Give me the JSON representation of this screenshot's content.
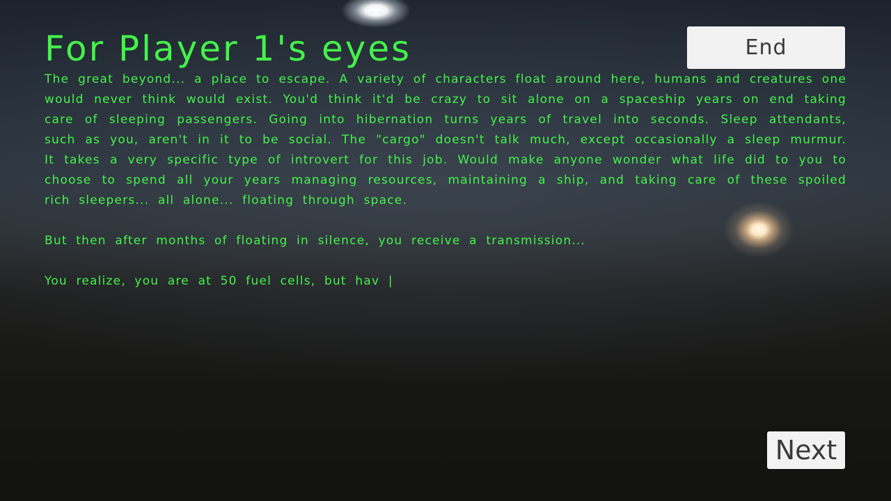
{
  "title": "For Player 1's eyes",
  "story": {
    "paragraph_1": "The great beyond... a place to escape. A variety of characters float around here, humans and creatures one would never think would exist. You'd think it'd be crazy to sit alone on a spaceship years on end taking care of sleeping passengers. Going into hibernation turns years of travel into seconds. Sleep attendants, such as you, aren't in it to be social. The \"cargo\" doesn't talk much, except occasionally a sleep murmur. It takes a very specific type of introvert for this job. Would make anyone wonder what life did to you to choose to spend all your years managing resources, maintaining a ship, and taking care of these spoiled rich sleepers... all alone... floating through space.",
    "paragraph_2": "But then after months of floating in silence, you receive a transmission...",
    "paragraph_3": "You realize, you are at 50 fuel cells, but hav |"
  },
  "buttons": {
    "end_label": "End",
    "next_label": "Next"
  },
  "colors": {
    "text_green": "#44f24a",
    "button_bg": "#f2f2f2",
    "button_text": "#3a3a3a"
  }
}
